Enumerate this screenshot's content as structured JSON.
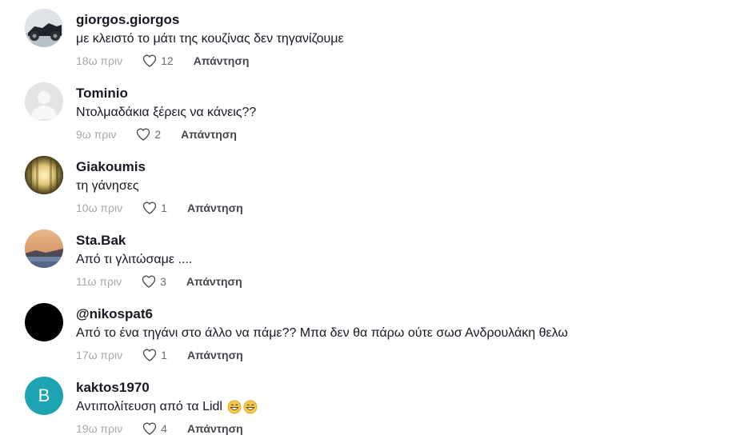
{
  "comments": [
    {
      "username": "giorgos.giorgos",
      "text": "με κλειστό το μάτι της κουζίνας δεν τηγανίζουμε",
      "time": "18ω πριν",
      "likes": "12",
      "reply_label": "Απάντηση",
      "avatar": {
        "type": "photo-bike"
      }
    },
    {
      "username": "Tominio",
      "text": "Ντολμαδάκια ξέρεις να κάνεις??",
      "time": "9ω πριν",
      "likes": "2",
      "reply_label": "Απάντηση",
      "avatar": {
        "type": "default-user"
      }
    },
    {
      "username": "Giakoumis",
      "text": "τη γάνησες",
      "time": "10ω πριν",
      "likes": "1",
      "reply_label": "Απάντηση",
      "avatar": {
        "type": "photo-gold"
      }
    },
    {
      "username": "Sta.Bak",
      "text": "Από τι γλιτώσαμε ....",
      "time": "11ω πριν",
      "likes": "3",
      "reply_label": "Απάντηση",
      "avatar": {
        "type": "photo-sunset"
      }
    },
    {
      "username": "@nikospat6",
      "text": "Από το ένα τηγάνι στο άλλο να πάμε?? Μπα δεν θα πάρω ούτε σωσ Ανδρουλάκη θελω",
      "time": "17ω πριν",
      "likes": "1",
      "reply_label": "Απάντηση",
      "avatar": {
        "type": "solid-black"
      }
    },
    {
      "username": "kaktos1970",
      "text": "Αντιπολίτευση από τα Lidl",
      "time": "19ω πριν",
      "likes": "4",
      "reply_label": "Απάντηση",
      "avatar": {
        "type": "letter",
        "letter": "B",
        "color": "#1ea3b3"
      },
      "emojis": [
        "grinning-sweat-emoji",
        "grinning-sweat-emoji"
      ]
    }
  ],
  "colors": {
    "username": "#161823",
    "time": "#a6a7ab",
    "like_icon": "#4a4b52",
    "reply": "#45464d"
  },
  "icons": {
    "like": "heart-outline-icon"
  }
}
